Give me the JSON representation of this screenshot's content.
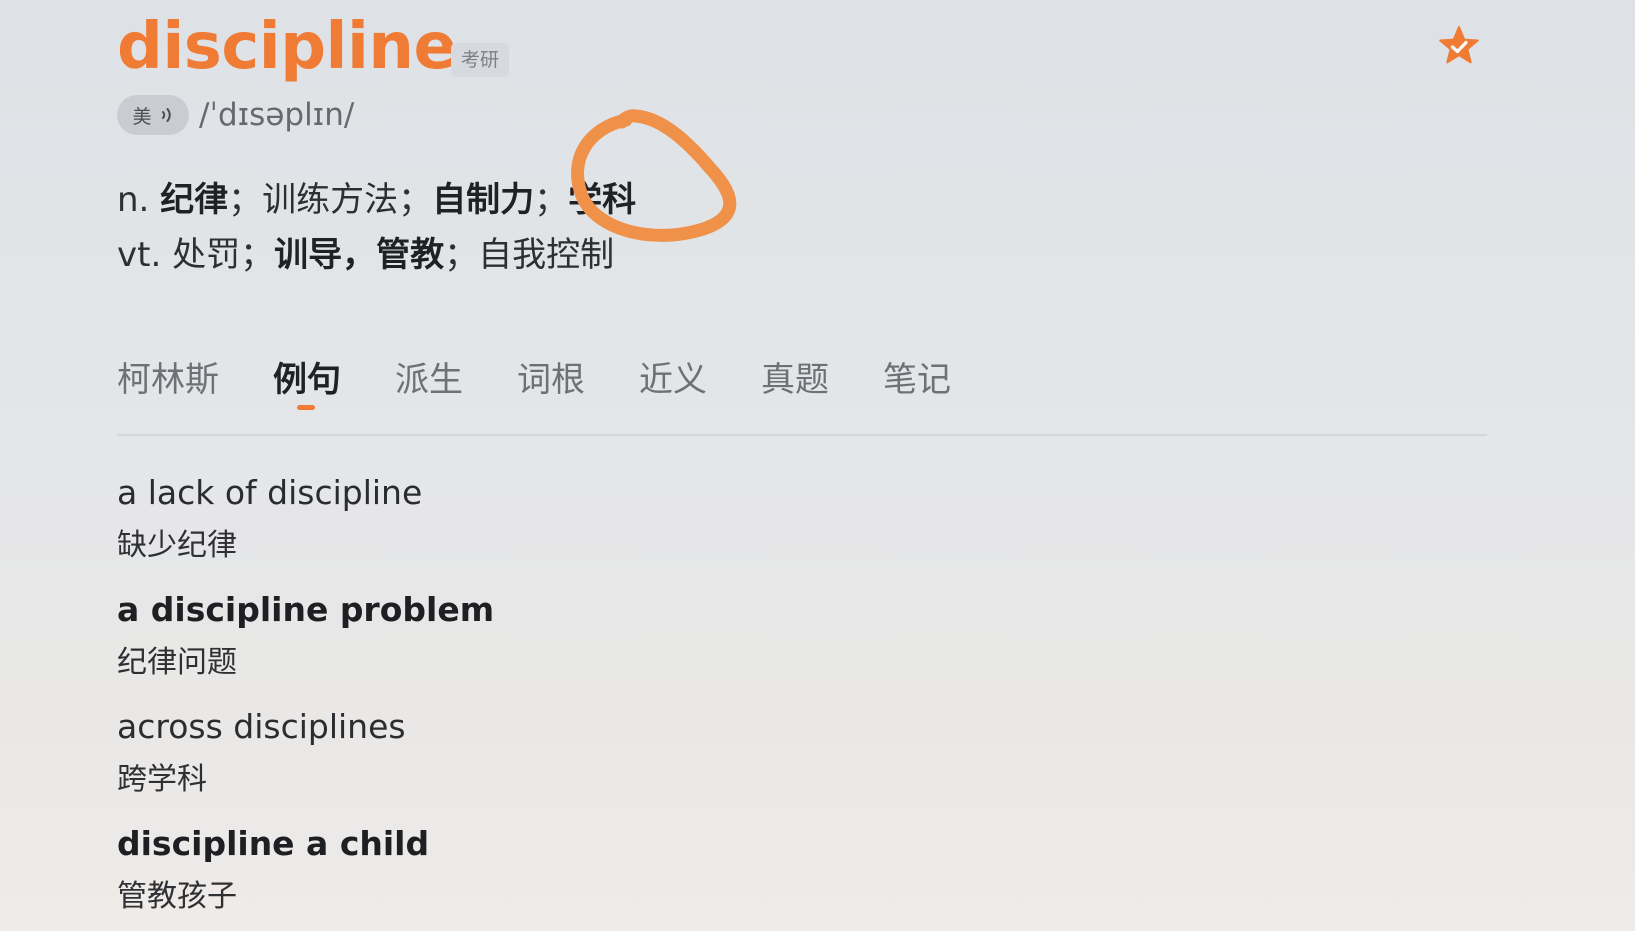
{
  "word": "discipline",
  "tag": "考研",
  "pronunciation": {
    "region": "美",
    "phonetic": "/ˈdɪsəplɪn/"
  },
  "definitions": [
    {
      "pos": "n.",
      "parts": [
        {
          "text": "纪律",
          "bold": true
        },
        {
          "text": "；训练方法；",
          "bold": false
        },
        {
          "text": "自制力",
          "bold": true
        },
        {
          "text": "；",
          "bold": false
        },
        {
          "text": "学科",
          "bold": true
        }
      ]
    },
    {
      "pos": "vt.",
      "parts": [
        {
          "text": "处罚；",
          "bold": false
        },
        {
          "text": "训导，管教",
          "bold": true
        },
        {
          "text": "；自我控制",
          "bold": false
        }
      ]
    }
  ],
  "tabs": [
    {
      "label": "柯林斯",
      "active": false
    },
    {
      "label": "例句",
      "active": true
    },
    {
      "label": "派生",
      "active": false
    },
    {
      "label": "词根",
      "active": false
    },
    {
      "label": "近义",
      "active": false
    },
    {
      "label": "真题",
      "active": false
    },
    {
      "label": "笔记",
      "active": false
    }
  ],
  "examples": [
    {
      "en": "a lack of discipline",
      "zh": "缺少纪律",
      "bold": false
    },
    {
      "en": "a discipline problem",
      "zh": "纪律问题",
      "bold": true
    },
    {
      "en": "across disciplines",
      "zh": "跨学科",
      "bold": false
    },
    {
      "en": "discipline a child",
      "zh": "管教孩子",
      "bold": true
    }
  ],
  "icons": {
    "favorite": "star-check-icon",
    "speaker": "speaker-icon",
    "annotation": "hand-drawn-circle"
  },
  "colors": {
    "accent": "#ef7b35",
    "annotation": "#f0914a"
  }
}
